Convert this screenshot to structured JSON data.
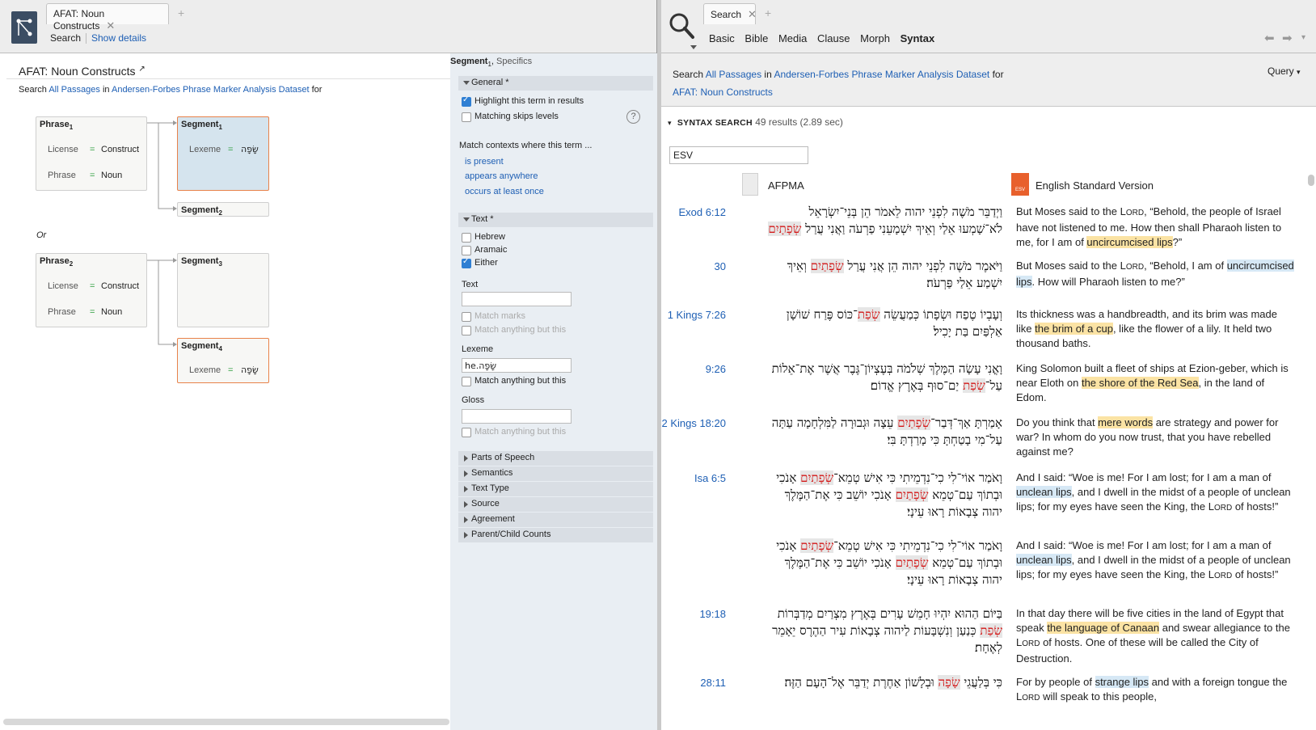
{
  "left": {
    "tab_title": "AFAT: Noun Constructs",
    "toolbar": {
      "search": "Search",
      "show_details": "Show details"
    },
    "doc_title": "AFAT: Noun Constructs",
    "search_line": {
      "prefix": "Search",
      "passages": "All Passages",
      "in": "in",
      "dataset": "Andersen-Forbes Phrase Marker Analysis Dataset",
      "for": "for"
    },
    "or_label": "Or",
    "nodes": {
      "phrase1": {
        "title": "Phrase",
        "sub": "1",
        "r1l": "License",
        "r1v": "Construct",
        "r2l": "Phrase",
        "r2v": "Noun"
      },
      "seg1": {
        "title": "Segment",
        "sub": "1",
        "r1l": "Lexeme",
        "r1v": "שָׂפָה"
      },
      "seg2": {
        "title": "Segment",
        "sub": "2"
      },
      "phrase2": {
        "title": "Phrase",
        "sub": "2",
        "r1l": "License",
        "r1v": "Construct",
        "r2l": "Phrase",
        "r2v": "Noun"
      },
      "seg3": {
        "title": "Segment",
        "sub": "3"
      },
      "seg4": {
        "title": "Segment",
        "sub": "4",
        "r1l": "Lexeme",
        "r1v": "שָׂפָה"
      }
    },
    "eq": "="
  },
  "sidepanel": {
    "title": "Segment",
    "title_sub": "1",
    "title_suffix": "Specifics",
    "general": "General *",
    "highlight": "Highlight this term in results",
    "skips": "Matching skips levels",
    "help": "?",
    "match_ctx": "Match contexts where this term ...",
    "ctx_opts": [
      "is present",
      "appears anywhere",
      "occurs at least once"
    ],
    "text_sec": "Text *",
    "langs": [
      "Hebrew",
      "Aramaic",
      "Either"
    ],
    "text_label": "Text",
    "match_marks": "Match marks",
    "match_but": "Match anything but this",
    "lexeme_label": "Lexeme",
    "lexeme_val": "he.שָׂפָה",
    "lex_but": "Match anything but this",
    "gloss_label": "Gloss",
    "gloss_but": "Match anything but this",
    "sections": [
      "Parts of Speech",
      "Semantics",
      "Text Type",
      "Source",
      "Agreement",
      "Parent/Child Counts"
    ]
  },
  "right": {
    "tab_title": "Search",
    "nav": [
      "Basic",
      "Bible",
      "Media",
      "Clause",
      "Morph",
      "Syntax"
    ],
    "search_line": {
      "prefix": "Search",
      "passages": "All Passages",
      "in": "in",
      "dataset": "Andersen-Forbes Phrase Marker Analysis Dataset",
      "for": "for",
      "query_name": "AFAT: Noun Constructs"
    },
    "query_btn": "Query",
    "results_label": "SYNTAX SEARCH",
    "results_count": "49 results (2.89 sec)",
    "filter_value": "ESV",
    "col1": "AFPMA",
    "col2": "English Standard Version",
    "esv_badge": "ESV",
    "rows": [
      {
        "ref": "Exod 6:12",
        "heb": [
          "וַיְדַבֵּר מֹשֶׁה לִפְנֵי יהוה לֵאמֹר הֵן בְּנֵי־יִשְׂרָאֵל",
          "לֹא־שָׁמְעוּ אֵלַי וְאֵיךְ יִשְׁמָעֵנִי פַרְעֹה וַאֲנִי עֲרַל שְׂפָתָיִם׃"
        ],
        "eng": "But Moses said to the LORD, “Behold, the people of Israel have not listened to me. How then shall Pharaoh listen to me, for I am of uncircumcised lips?”"
      },
      {
        "ref": "30",
        "heb": [
          "וַיֹּאמֶר מֹשֶׁה לִפְנֵי יהוה הֵן אֲנִי עֲרַל שְׂפָתַיִם וְאֵיךְ",
          "יִשְׁמַע אֵלַי פַּרְעֹה׃"
        ],
        "eng": "But Moses said to the LORD, “Behold, I am of uncircumcised lips. How will Pharaoh listen to me?”"
      },
      {
        "ref": "1 Kings 7:26",
        "heb": [
          "וְעָבְיוֹ טֶפַח וּשְׂפָתוֹ כְּמַעֲשֵׂה שְׂפַת־כּוֹס פֶּרַח שׁוֹשָׁן",
          "אַלְפַּיִם בַּת יָכִיל׃"
        ],
        "eng": "Its thickness was a handbreadth, and its brim was made like the brim of a cup, like the flower of a lily. It held two thousand baths."
      },
      {
        "ref": "9:26",
        "heb": [
          "וָאֳנִי עָשָׂה הַמֶּלֶךְ שְׁלֹמֹה בְּעֶצְיוֹן־גֶּבֶר אֲשֶׁר אֶת־אֵלוֹת",
          "עַל־שְׂפַת יַם־סוּף בְּאֶרֶץ אֱדוֹם׃"
        ],
        "eng": "King Solomon built a fleet of ships at Ezion-geber, which is near Eloth on the shore of the Red Sea, in the land of Edom."
      },
      {
        "ref": "2 Kings 18:20",
        "heb": [
          "אָמַרְתָּ אַךְ־דְּבַר־שְׂפָתַיִם עֵצָה וּגְבוּרָה לַמִּלְחָמָה עַתָּה",
          "עַל־מִי בָטַחְתָּ כִּי מָרַדְתָּ בִּי׃"
        ],
        "eng": "Do you think that mere words are strategy and power for war? In whom do you now trust, that you have rebelled against me?"
      },
      {
        "ref": "Isa 6:5",
        "heb": [
          "וָאֹמַר אוֹי־לִי כִי־נִדְמֵיתִי כִּי אִישׁ טְמֵא־שְׂפָתַיִם אָנֹכִי",
          "וּבְתוֹךְ עַם־טְמֵא שְׂפָתַיִם אָנֹכִי יוֹשֵׁב כִּי אֶת־הַמֶּלֶךְ",
          "יהוה צְבָאוֹת רָאוּ עֵינָי׃"
        ],
        "eng": "And I said: “Woe is me! For I am lost; for I am a man of unclean lips, and I dwell in the midst of a people of unclean lips; for my eyes have seen the King, the LORD of hosts!”"
      },
      {
        "ref": "",
        "heb": [
          "וָאֹמַר אוֹי־לִי כִי־נִדְמֵיתִי כִּי אִישׁ טְמֵא־שְׂפָתַיִם אָנֹכִי",
          "וּבְתוֹךְ עַם־טְמֵא שְׂפָתַיִם אָנֹכִי יוֹשֵׁב כִּי אֶת־הַמֶּלֶךְ",
          "יהוה צְבָאוֹת רָאוּ עֵינָי׃"
        ],
        "eng": "And I said: “Woe is me! For I am lost; for I am a man of unclean lips, and I dwell in the midst of a people of unclean lips; for my eyes have seen the King, the LORD of hosts!”"
      },
      {
        "ref": "19:18",
        "heb": [
          "בַּיּוֹם הַהוּא יִהְיוּ חָמֵשׁ עָרִים בְּאֶרֶץ מִצְרַיִם מְדַבְּרוֹת",
          "שְׂפַת כְּנַעַן וְנִשְׁבָּעוֹת לַיהוה צְבָאוֹת עִיר הַהֶרֶס יֵאָמֵר",
          "לְאֶחָת׃"
        ],
        "eng": "In that day there will be five cities in the land of Egypt that speak the language of Canaan and swear allegiance to the LORD of hosts. One of these will be called the City of Destruction."
      },
      {
        "ref": "28:11",
        "heb": [
          "כִּי בְּלַעֲגֵי שָׂפָה וּבְלָשׁוֹן אַחֶרֶת יְדַבֵּר אֶל־הָעָם הַזֶּה׃"
        ],
        "eng": "For by people of strange lips and with a foreign tongue the LORD will speak to this people,"
      }
    ]
  },
  "colors": {
    "accent_link": "#1e5fb4",
    "selection_border": "#e8824a",
    "hebrew_match": "#d31a1a",
    "highlight_yellow": "#fbe3a4",
    "highlight_blue": "#d6e8f5"
  }
}
